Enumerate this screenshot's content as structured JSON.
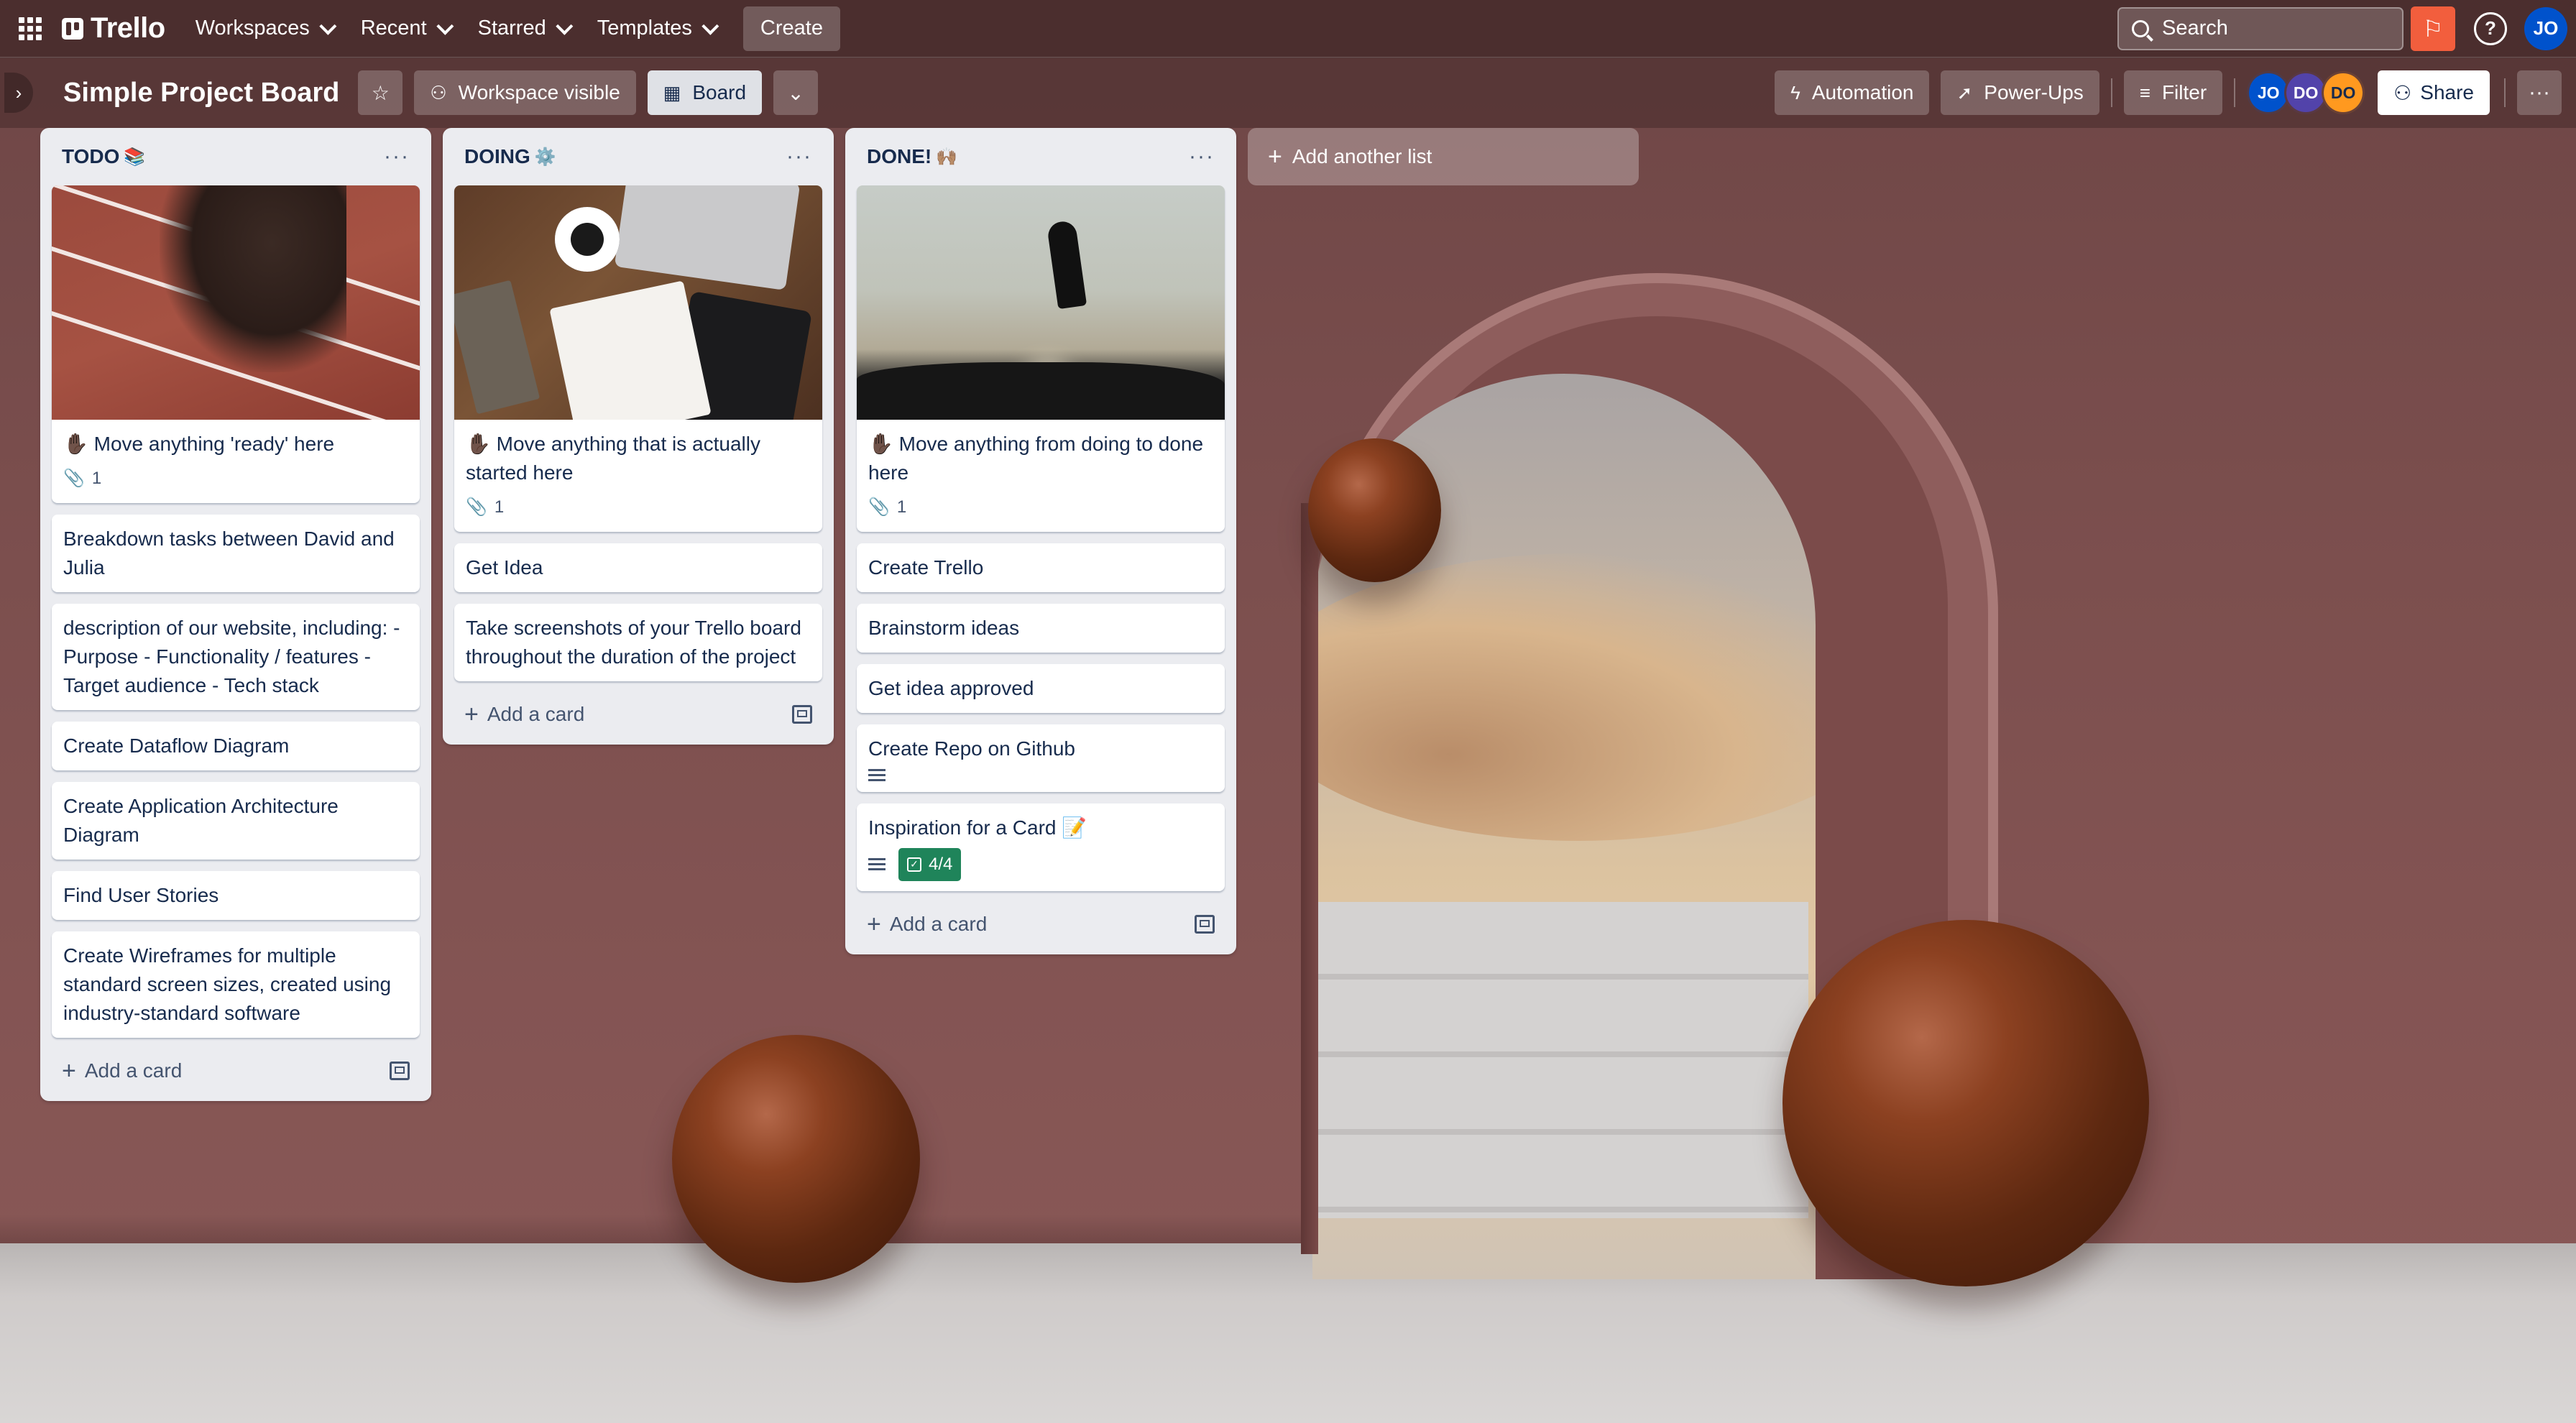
{
  "nav": {
    "brand": "Trello",
    "workspaces": "Workspaces",
    "recent": "Recent",
    "starred": "Starred",
    "templates": "Templates",
    "create": "Create",
    "search_placeholder": "Search",
    "help": "?",
    "user_initials": "JO"
  },
  "board": {
    "title": "Simple Project Board",
    "visibility": "Workspace visible",
    "view": "Board",
    "automation": "Automation",
    "powerups": "Power-Ups",
    "filter": "Filter",
    "share": "Share",
    "members": [
      "JO",
      "DO",
      "DO"
    ],
    "add_list": "Add another list"
  },
  "lists": [
    {
      "title": "TODO",
      "title_emoji": "📚",
      "cover_card": {
        "text": "✋🏿 Move anything 'ready' here",
        "attachments": "1"
      },
      "cards": [
        "Breakdown tasks between David and Julia",
        "description of our website, including: - Purpose - Functionality / features - Target audience - Tech stack",
        "Create Dataflow Diagram",
        "Create Application Architecture Diagram",
        "Find User Stories",
        "Create Wireframes for multiple standard screen sizes, created using industry-standard software"
      ],
      "add_card": "Add a card"
    },
    {
      "title": "DOING",
      "title_emoji": "⚙️",
      "cover_card": {
        "text": "✋🏿 Move anything that is actually started here",
        "attachments": "1"
      },
      "cards": [
        "Get Idea",
        "Take screenshots of your Trello board throughout the duration of the project"
      ],
      "add_card": "Add a card"
    },
    {
      "title": "DONE!",
      "title_emoji": "🙌🏽",
      "cover_card": {
        "text": "✋🏿 Move anything from doing to done here",
        "attachments": "1"
      },
      "cards": [
        "Create Trello",
        "Brainstorm ideas",
        "Get idea approved",
        "Create Repo on Github",
        "Inspiration for a Card 📝"
      ],
      "checklist": "4/4",
      "add_card": "Add a card"
    }
  ],
  "colors": {
    "accent_blue": "#0052cc",
    "notify_orange": "#f25e3d",
    "checklist_green": "#1f845a"
  }
}
